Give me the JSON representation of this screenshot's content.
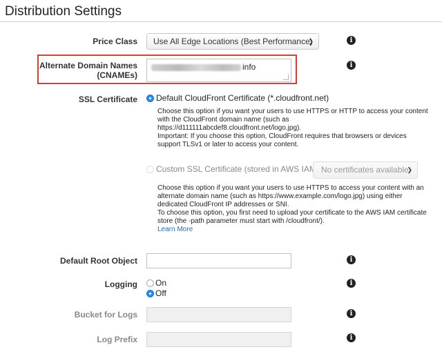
{
  "page": {
    "title": "Distribution Settings"
  },
  "price_class": {
    "label": "Price Class",
    "selected": "Use All Edge Locations (Best Performance)"
  },
  "cnames": {
    "label_line1": "Alternate Domain Names",
    "label_line2": "(CNAMEs)",
    "value_suffix": "info"
  },
  "ssl": {
    "label": "SSL Certificate",
    "default_option": "Default CloudFront Certificate (*.cloudfront.net)",
    "default_help": [
      "Choose this option if you want your users to use HTTPS or HTTP to access your content",
      "with the CloudFront domain name (such as",
      "https://d111111abcdef8.cloudfront.net/logo.jpg).",
      "Important: If you choose this option, CloudFront requires that browsers or devices",
      "support TLSv1 or later to access your content."
    ],
    "custom_option": "Custom SSL Certificate (stored in AWS IAM):",
    "custom_select": "No certificates available",
    "custom_help": [
      "Choose this option if you want your users to use HTTPS to access your content with an",
      "alternate domain name (such as https://www.example.com/logo.jpg) using either",
      "dedicated CloudFront IP addresses or SNI.",
      "To choose this option, you first need to upload your certificate to the AWS IAM certificate",
      "store (the -path parameter must start with /cloudfront/)."
    ],
    "learn_more": "Learn More"
  },
  "default_root_object": {
    "label": "Default Root Object",
    "value": ""
  },
  "logging": {
    "label": "Logging",
    "on_label": "On",
    "off_label": "Off",
    "selected": "Off"
  },
  "bucket_for_logs": {
    "label": "Bucket for Logs",
    "value": ""
  },
  "log_prefix": {
    "label": "Log Prefix",
    "value": ""
  },
  "info_glyph": "i",
  "colors": {
    "accent": "#2e8ee8",
    "highlight": "#e0392b",
    "link": "#1a6fc9"
  }
}
